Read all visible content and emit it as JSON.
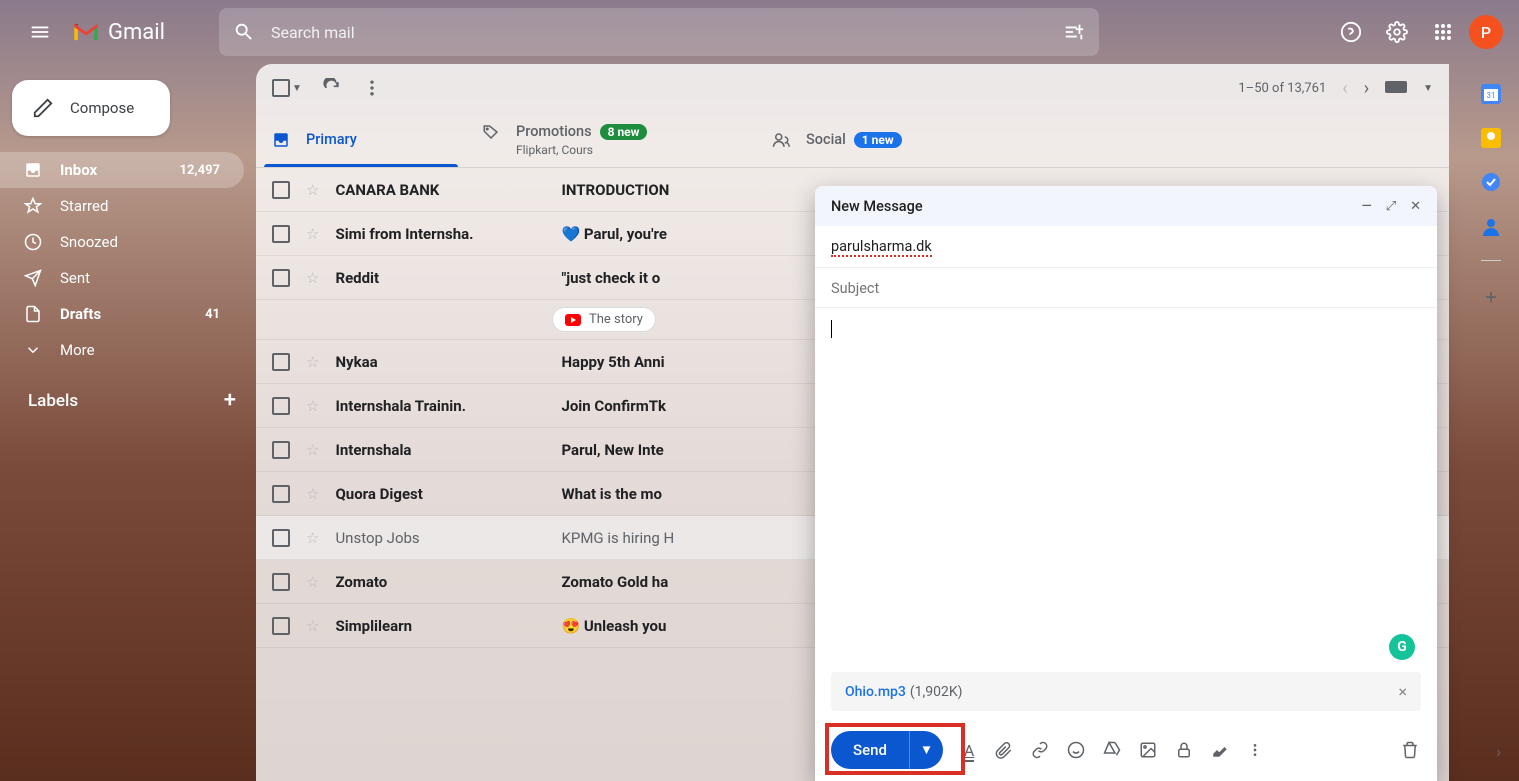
{
  "header": {
    "app_name": "Gmail",
    "search_placeholder": "Search mail",
    "avatar_initial": "P"
  },
  "sidebar": {
    "compose": "Compose",
    "items": [
      {
        "label": "Inbox",
        "count": "12,497",
        "bold": true,
        "active": true,
        "icon": "inbox"
      },
      {
        "label": "Starred",
        "icon": "star"
      },
      {
        "label": "Snoozed",
        "icon": "clock"
      },
      {
        "label": "Sent",
        "icon": "send"
      },
      {
        "label": "Drafts",
        "count": "41",
        "bold": true,
        "icon": "file"
      },
      {
        "label": "More",
        "icon": "chevron"
      }
    ],
    "labels_title": "Labels"
  },
  "toolbar": {
    "pagination": "1–50 of 13,761"
  },
  "tabs": {
    "primary": "Primary",
    "promotions_label": "Promotions",
    "promotions_badge": "8 new",
    "promotions_sub": "Flipkart, Cours",
    "social_label": "Social",
    "social_badge": "1 new"
  },
  "mails": [
    {
      "sender": "CANARA BANK",
      "subject": "INTRODUCTION",
      "read": false
    },
    {
      "sender": "Simi from Internsha.",
      "subject": "💙 Parul, you're",
      "read": false
    },
    {
      "sender": "Reddit",
      "subject": "\"just check it o",
      "read": false,
      "has_sub": true,
      "sub_text": "The story "
    },
    {
      "sender": "Nykaa",
      "subject": "Happy 5th Anni",
      "read": false
    },
    {
      "sender": "Internshala Trainin.",
      "subject": "Join ConfirmTk",
      "read": false
    },
    {
      "sender": "Internshala",
      "subject": "Parul, New Inte",
      "read": false
    },
    {
      "sender": "Quora Digest",
      "subject": "What is the mo",
      "read": false
    },
    {
      "sender": "Unstop Jobs",
      "subject": "KPMG is hiring H",
      "read": true
    },
    {
      "sender": "Zomato",
      "subject": "Zomato Gold ha",
      "read": false
    },
    {
      "sender": "Simplilearn",
      "subject": "😍 Unleash you",
      "read": false
    }
  ],
  "compose_window": {
    "title": "New Message",
    "to": "parulsharma.dk",
    "subject_placeholder": "Subject",
    "attachment_name": "Ohio.mp3",
    "attachment_size": "(1,902K)",
    "send_label": "Send"
  }
}
